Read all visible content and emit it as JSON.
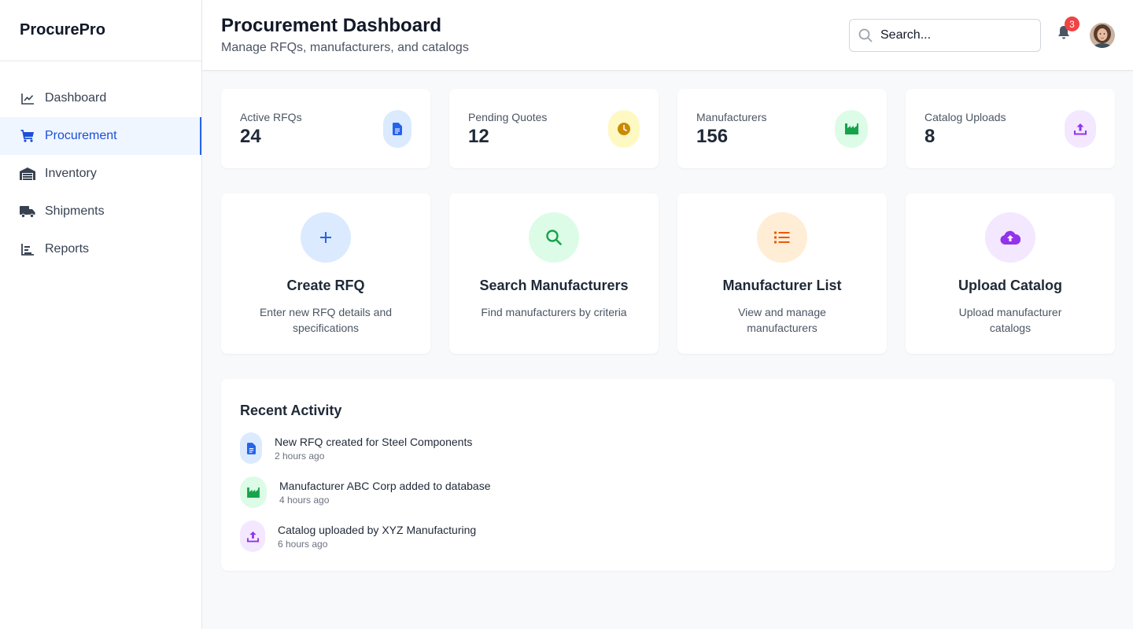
{
  "app": {
    "brand": "ProcurePro"
  },
  "sidebar": {
    "items": [
      {
        "label": "Dashboard",
        "icon": "chart-line-icon",
        "active": false
      },
      {
        "label": "Procurement",
        "icon": "shopping-cart-icon",
        "active": true
      },
      {
        "label": "Inventory",
        "icon": "warehouse-icon",
        "active": false
      },
      {
        "label": "Shipments",
        "icon": "truck-icon",
        "active": false
      },
      {
        "label": "Reports",
        "icon": "bar-chart-icon",
        "active": false
      }
    ]
  },
  "header": {
    "title": "Procurement Dashboard",
    "subtitle": "Manage RFQs, manufacturers, and catalogs",
    "search_placeholder": "Search...",
    "notification_count": "3"
  },
  "stats": [
    {
      "label": "Active RFQs",
      "value": "24",
      "icon": "file-icon",
      "color": "#2563eb",
      "bg": "#dbeafe"
    },
    {
      "label": "Pending Quotes",
      "value": "12",
      "icon": "clock-icon",
      "color": "#ca8a04",
      "bg": "#fef9c3"
    },
    {
      "label": "Manufacturers",
      "value": "156",
      "icon": "factory-icon",
      "color": "#16a34a",
      "bg": "#dcfce7"
    },
    {
      "label": "Catalog Uploads",
      "value": "8",
      "icon": "upload-icon",
      "color": "#9333ea",
      "bg": "#f3e8ff"
    }
  ],
  "actions": [
    {
      "title": "Create RFQ",
      "description": "Enter new RFQ details and specifications",
      "icon": "plus-icon",
      "color": "#2563eb",
      "bg": "#dbeafe"
    },
    {
      "title": "Search Manufacturers",
      "description": "Find manufacturers by criteria",
      "icon": "search-icon",
      "color": "#16a34a",
      "bg": "#dcfce7"
    },
    {
      "title": "Manufacturer List",
      "description": "View and manage manufacturers",
      "icon": "list-icon",
      "color": "#ea580c",
      "bg": "#ffedd5"
    },
    {
      "title": "Upload Catalog",
      "description": "Upload manufacturer catalogs",
      "icon": "cloud-upload-icon",
      "color": "#9333ea",
      "bg": "#f3e8ff"
    }
  ],
  "activity": {
    "title": "Recent Activity",
    "items": [
      {
        "text": "New RFQ created for Steel Components",
        "time": "2 hours ago",
        "icon": "file-icon",
        "color": "#2563eb",
        "bg": "#dbeafe"
      },
      {
        "text": "Manufacturer ABC Corp added to database",
        "time": "4 hours ago",
        "icon": "factory-icon",
        "color": "#16a34a",
        "bg": "#dcfce7"
      },
      {
        "text": "Catalog uploaded by XYZ Manufacturing",
        "time": "6 hours ago",
        "icon": "upload-icon",
        "color": "#9333ea",
        "bg": "#f3e8ff"
      }
    ]
  }
}
